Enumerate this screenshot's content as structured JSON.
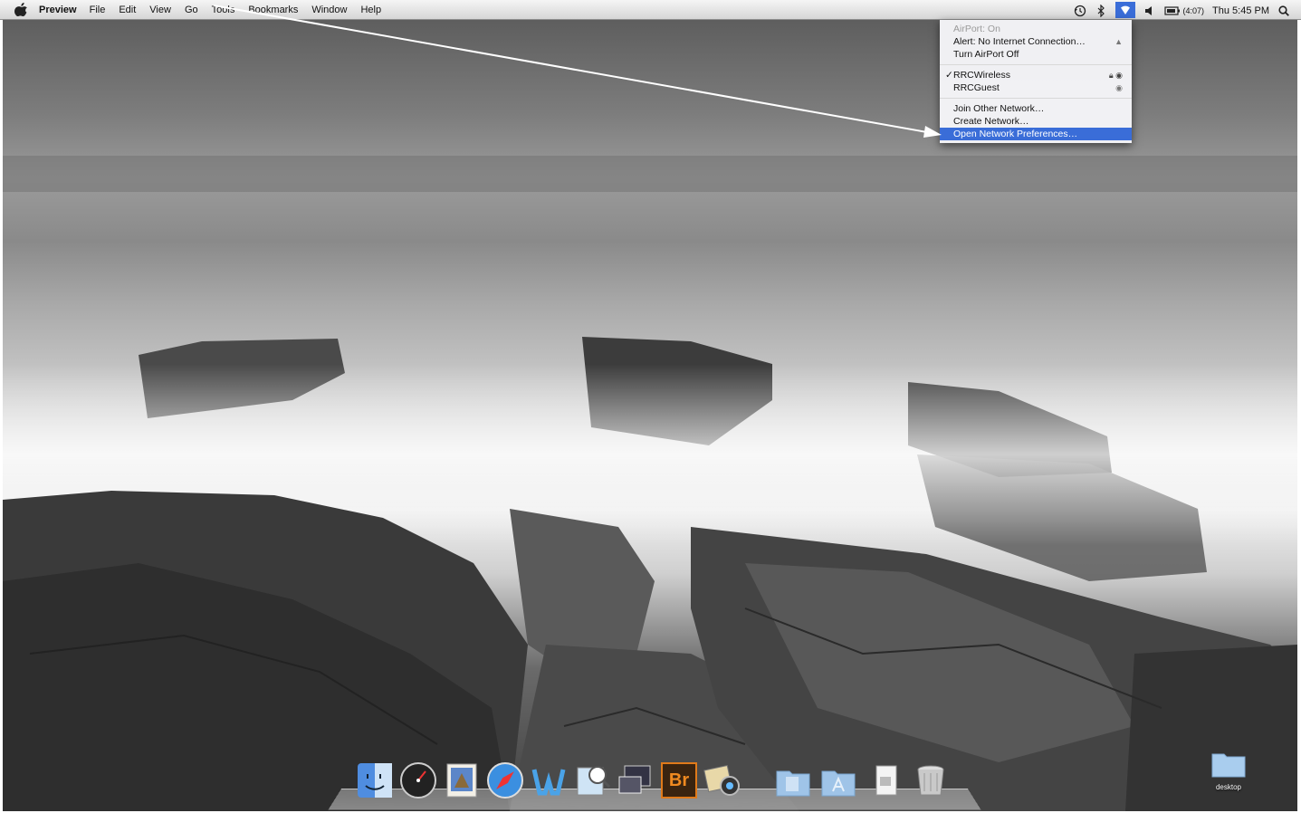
{
  "menubar": {
    "app_name": "Preview",
    "items": [
      "File",
      "Edit",
      "View",
      "Go",
      "Tools",
      "Bookmarks",
      "Window",
      "Help"
    ],
    "battery": "(4:07)",
    "clock": "Thu 5:45 PM",
    "icons": [
      "apple-icon",
      "time-machine-icon",
      "bluetooth-icon",
      "airport-icon",
      "volume-icon",
      "battery-icon",
      "spotlight-icon"
    ]
  },
  "airport_menu": {
    "status": "AirPort: On",
    "alert": "Alert: No Internet Connection…",
    "toggle": "Turn AirPort Off",
    "networks": [
      {
        "name": "RRCWireless",
        "checked": true,
        "locked": true
      },
      {
        "name": "RRCGuest",
        "checked": false,
        "locked": false
      }
    ],
    "join_other": "Join Other Network…",
    "create": "Create Network…",
    "preferences": "Open Network Preferences…"
  },
  "dock": {
    "items": [
      "Finder",
      "Dashboard",
      "Mail",
      "Safari",
      "iWork",
      "Preview",
      "Screen Sharing",
      "Adobe Bridge",
      "iPhoto",
      "Documents",
      "Applications",
      "Downloads",
      "Trash"
    ],
    "bridge_label": "Br"
  },
  "desktop_folder": {
    "label": "desktop"
  },
  "colors": {
    "highlight": "#3a6dd8",
    "accent_bar": "#7a1e1e"
  }
}
